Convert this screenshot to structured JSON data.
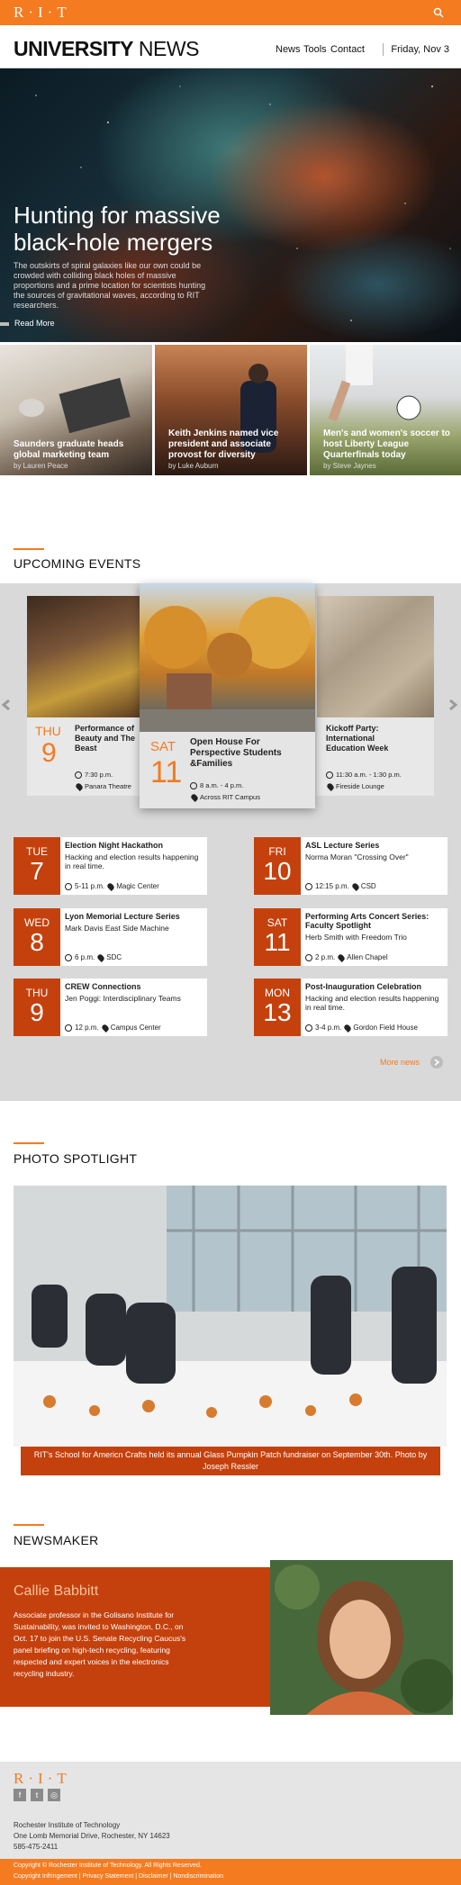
{
  "header": {
    "logo": "R·I·T",
    "brand_bold": "UNIVERSITY",
    "brand_light": " NEWS",
    "nav": [
      "News",
      "Tools",
      "Contact"
    ],
    "date": "Friday, Nov 3"
  },
  "hero": {
    "title": "Hunting for massive black-hole mergers",
    "text": "The outskirts of spiral galaxies like our own could be crowded with colliding black holes of massive proportions and a prime location for scientists hunting the sources of gravitational waves, according to RIT researchers.",
    "more": "Read More"
  },
  "stories": [
    {
      "title": "Saunders graduate heads global marketing team",
      "byline": "by Lauren Peace"
    },
    {
      "title": "Keith Jenkins named vice president and associate provost for diversity",
      "byline": "by Luke Auburn"
    },
    {
      "title": "Men's and women's soccer to host Liberty League Quarterfinals today",
      "byline": "by Steve Jaynes"
    }
  ],
  "events": {
    "heading": "UPCOMING EVENTS",
    "carousel": [
      {
        "day": "THU",
        "num": "9",
        "title": "Performance of Beauty and The Beast",
        "time": "7:30 p.m.",
        "place": "Panara Theatre"
      },
      {
        "day": "SAT",
        "num": "11",
        "title": "Open House For Perspective Students &Families",
        "time": "8 a.m. - 4 p.m.",
        "place": "Across RIT Campus"
      },
      {
        "day": "",
        "num": "",
        "title": "Kickoff Party: International Education Week",
        "time": "11:30 a.m. - 1:30 p.m.",
        "place": "Fireside Lounge"
      }
    ],
    "list": [
      {
        "day": "TUE",
        "num": "7",
        "title": "Election Night Hackathon",
        "sub": "Hacking and election results happening in real time.",
        "time": "5-11 p.m.",
        "place": "Magic Center"
      },
      {
        "day": "FRI",
        "num": "10",
        "title": "ASL Lecture Series",
        "sub": "Norma Moran \"Crossing Over\"",
        "time": "12:15 p.m.",
        "place": "CSD"
      },
      {
        "day": "WED",
        "num": "8",
        "title": "Lyon Memorial Lecture Series",
        "sub": "Mark Davis East Side Machine",
        "time": "6 p.m.",
        "place": "SDC"
      },
      {
        "day": "SAT",
        "num": "11",
        "title": "Performing Arts Concert Series: Faculty Spotlight",
        "sub": "Herb Smith with Freedom Trio",
        "time": "2 p.m.",
        "place": "Allen Chapel"
      },
      {
        "day": "THU",
        "num": "9",
        "title": "CREW Connections",
        "sub": "Jen Poggi: Interdisciplinary Teams",
        "time": "12 p.m.",
        "place": "Campus Center"
      },
      {
        "day": "MON",
        "num": "13",
        "title": "Post-Inauguration Celebration",
        "sub": "Hacking and election results happening in real time.",
        "time": "3-4 p.m.",
        "place": "Gordon Field House"
      }
    ],
    "more": "More news"
  },
  "photo": {
    "heading": "PHOTO SPOTLIGHT",
    "caption": "RIT's School for Americn Crafts held its annual Glass Pumpkin Patch fundraiser on September 30th. Photo by Joseph Ressler"
  },
  "newsmaker": {
    "heading": "NEWSMAKER",
    "name": "Callie Babbitt",
    "text": "Associate professor in the Golisano Institute for Sustainability, was invited to Washington, D.C., on Oct. 17 to join the U.S. Senate Recycling Caucus's panel briefing on high-tech recycling, featuring respected and expert voices in the electronics recycling industry."
  },
  "footer": {
    "logo": "R·I·T",
    "social": [
      "f",
      "t",
      "◎"
    ],
    "lines": [
      "Rochester Institute of Technology",
      "One Lomb Memorial Drive, Rochester, NY 14623",
      "585-475-2411"
    ],
    "copyright": "Copyright © Rochester Institute of Technology. All Rights Reserved.",
    "links": "Copyright Infringement | Privacy Statement | Disclaimer | Nondiscrimination"
  },
  "colors": {
    "orange": "#f47b20",
    "rust": "#c4410d"
  }
}
